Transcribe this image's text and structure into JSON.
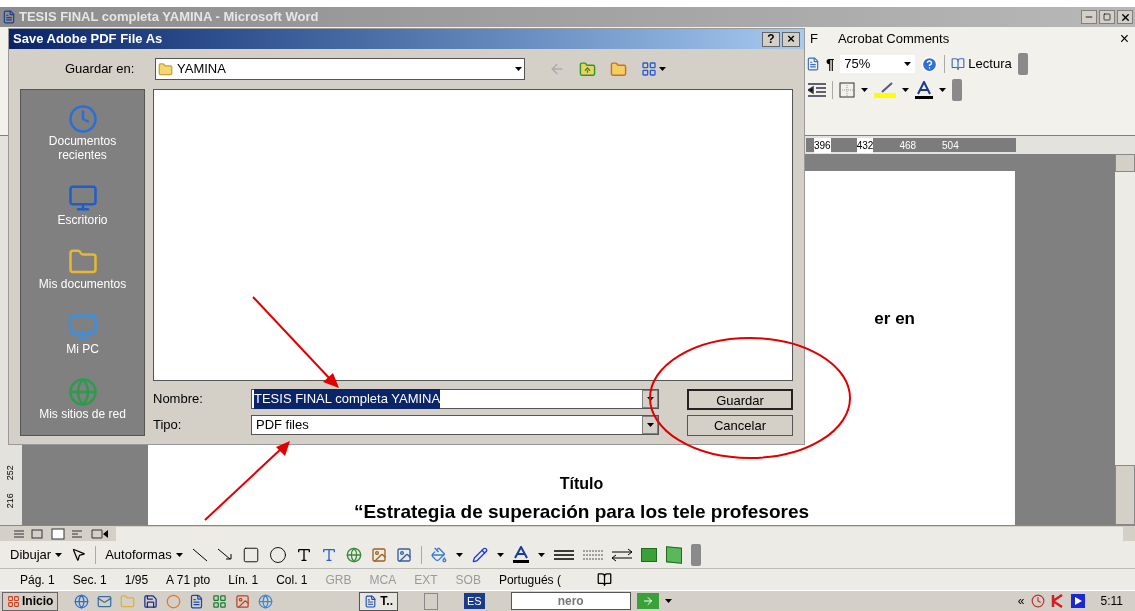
{
  "window": {
    "title": "TESIS FINAL completa YAMINA - Microsoft Word"
  },
  "menu": [
    {
      "label": "F"
    },
    {
      "label": "Acrobat Comments"
    }
  ],
  "menu_close": "×",
  "toolbar": {
    "pilcrow": "¶",
    "zoom": "75%",
    "reading": "Lectura"
  },
  "ruler": [
    "396",
    "432",
    "468",
    "504"
  ],
  "vertical_ruler": [
    "252",
    "216"
  ],
  "document": {
    "lines": [
      {
        "kind": "fragment",
        "text": "er en"
      },
      {
        "kind": "heading",
        "text": "Título"
      },
      {
        "kind": "title",
        "text": "“Estrategia de superación para los tele profesores"
      }
    ]
  },
  "drawing_toolbar": {
    "draw_menu": "Dibujar",
    "autoshapes_menu": "Autoformas"
  },
  "status_bar": [
    {
      "text": "Pág. 1",
      "disabled": false
    },
    {
      "text": "Sec. 1",
      "disabled": false
    },
    {
      "text": "1/95",
      "disabled": false
    },
    {
      "text": "A 71 pto",
      "disabled": false
    },
    {
      "text": "Lín. 1",
      "disabled": false
    },
    {
      "text": "Col. 1",
      "disabled": false
    },
    {
      "text": "GRB",
      "disabled": true
    },
    {
      "text": "MCA",
      "disabled": true
    },
    {
      "text": "EXT",
      "disabled": true
    },
    {
      "text": "SOB",
      "disabled": true
    },
    {
      "text": "Portugués (",
      "disabled": false
    }
  ],
  "taskbar": {
    "start": "Inicio",
    "task": "T..",
    "language": "ES",
    "search_logo": "nero",
    "overflow": "«",
    "clock": "5:11"
  },
  "dialog": {
    "title": "Save Adobe PDF File As",
    "help": "?",
    "close": "×",
    "save_in_label": "Guardar en:",
    "save_in_value": "YAMINA",
    "places": [
      {
        "kind": "recent",
        "label": "Documentos recientes"
      },
      {
        "kind": "desktop",
        "label": "Escritorio"
      },
      {
        "kind": "documents",
        "label": "Mis documentos"
      },
      {
        "kind": "computer",
        "label": "Mi PC"
      },
      {
        "kind": "network",
        "label": "Mis sitios de red"
      }
    ],
    "file_name": {
      "label": "Nombre:",
      "value": "TESIS FINAL completa YAMINA",
      "selected": true
    },
    "file_type": {
      "label": "Tipo:",
      "value": "PDF files"
    },
    "buttons": [
      {
        "label": "Guardar",
        "kind": "default"
      },
      {
        "label": "Cancelar",
        "kind": "normal"
      }
    ]
  }
}
